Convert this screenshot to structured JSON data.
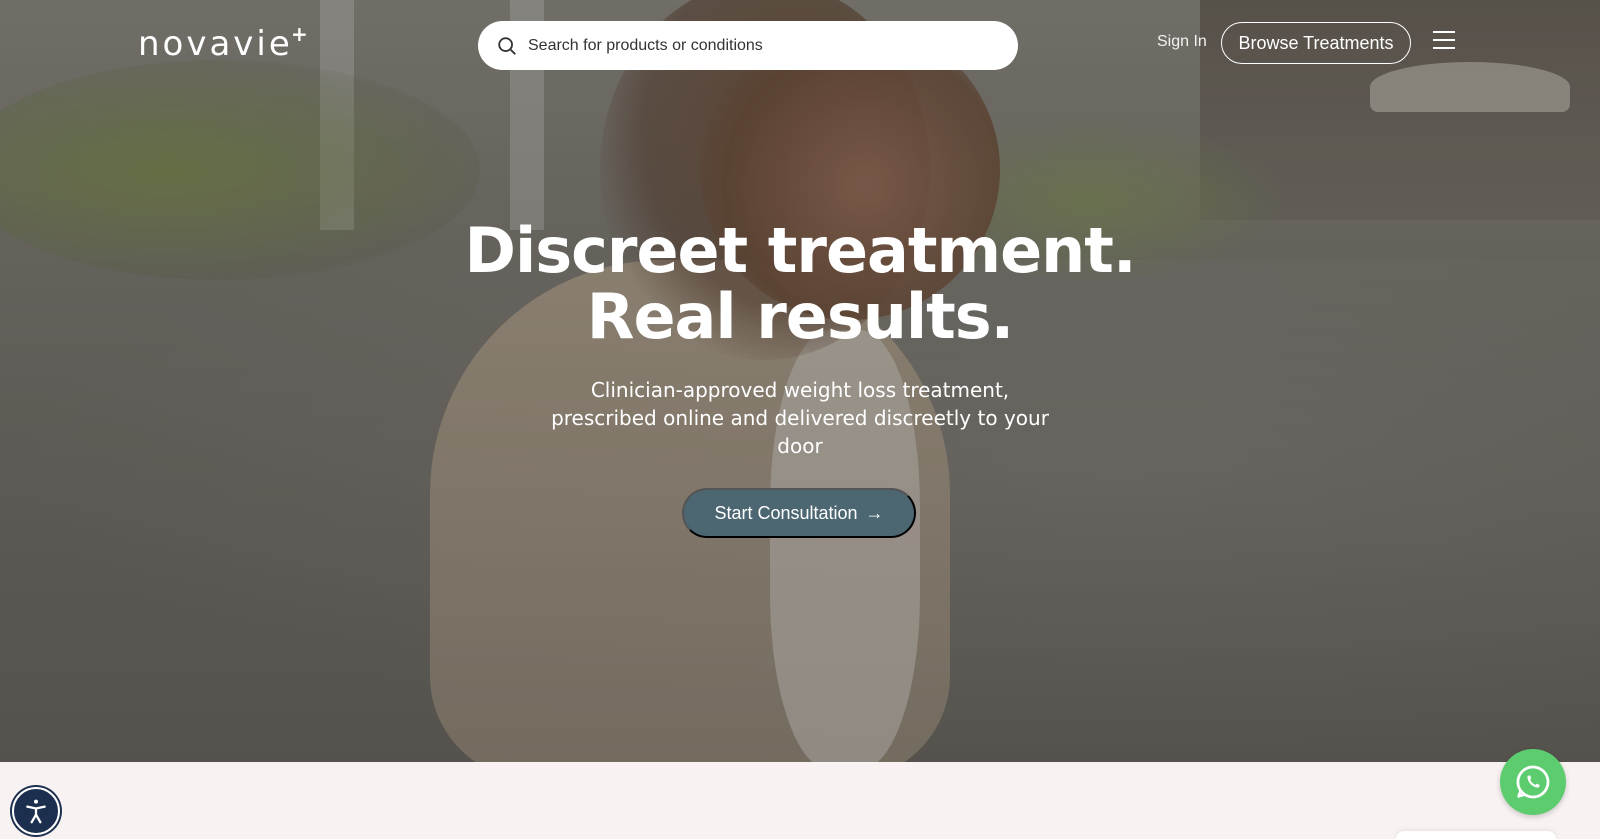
{
  "header": {
    "logo_text": "novavie",
    "logo_mark": "+",
    "search_placeholder": "Search for products or conditions",
    "sign_in_label": "Sign In",
    "browse_label": "Browse Treatments",
    "menu_icon": "hamburger-menu-icon"
  },
  "hero": {
    "title_line1": "Discreet treatment.",
    "title_line2": "Real results.",
    "subtitle": "Clinician-approved weight loss treatment, prescribed online and delivered discreetly to your door",
    "cta_label": "Start Consultation",
    "cta_arrow": "→"
  },
  "widgets": {
    "accessibility_icon": "accessibility-icon",
    "whatsapp_icon": "whatsapp-icon"
  },
  "colors": {
    "cta": "#4c6672",
    "whatsapp": "#5dcc6f",
    "accessibility": "#1c2f4e",
    "page_background": "#f8f3f2"
  }
}
